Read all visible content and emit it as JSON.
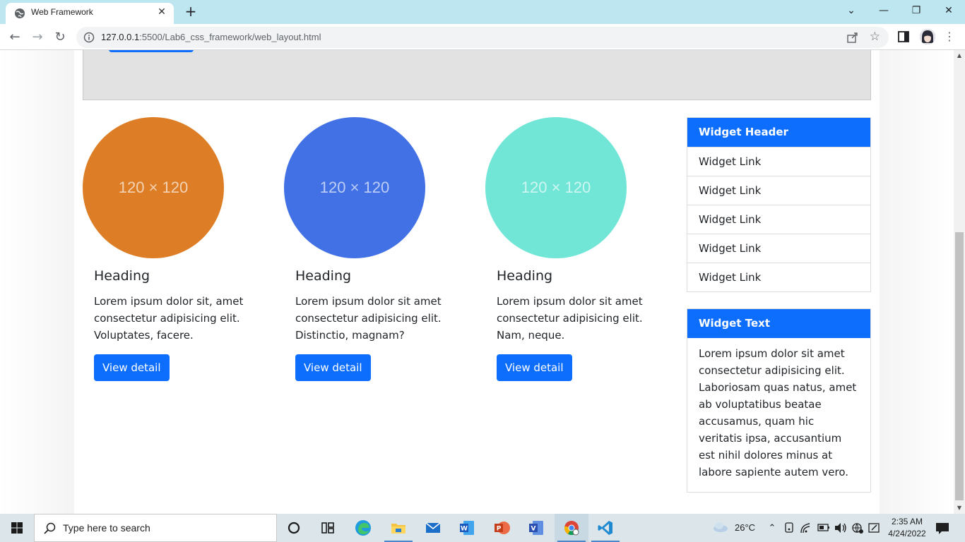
{
  "browser": {
    "tab_title": "Web Framework",
    "url_host": "127.0.0.1",
    "url_rest": ":5500/Lab6_css_framework/web_layout.html"
  },
  "page": {
    "cards": [
      {
        "placeholder": "120 × 120",
        "color": "#dd7e26",
        "heading": "Heading",
        "text": "Lorem ipsum dolor sit, amet consectetur adipisicing elit. Voluptates, facere.",
        "button": "View detail"
      },
      {
        "placeholder": "120 × 120",
        "color": "#4171e4",
        "heading": "Heading",
        "text": "Lorem ipsum dolor sit amet consectetur adipisicing elit. Distinctio, magnam?",
        "button": "View detail"
      },
      {
        "placeholder": "120 × 120",
        "color": "#71e6d6",
        "heading": "Heading",
        "text": "Lorem ipsum dolor sit amet consectetur adipisicing elit. Nam, neque.",
        "button": "View detail"
      }
    ],
    "widget_links": {
      "header": "Widget Header",
      "links": [
        "Widget Link",
        "Widget Link",
        "Widget Link",
        "Widget Link",
        "Widget Link"
      ]
    },
    "widget_text": {
      "header": "Widget Text",
      "body": "Lorem ipsum dolor sit amet consectetur adipisicing elit. Laboriosam quas natus, amet ab voluptatibus beatae accusamus, quam hic veritatis ipsa, accusantium est nihil dolores minus at labore sapiente autem vero."
    }
  },
  "taskbar": {
    "search_placeholder": "Type here to search",
    "weather": "26°C",
    "time": "2:35 AM",
    "date": "4/24/2022"
  },
  "colors": {
    "primary": "#0d6efd",
    "tabbar": "#bde6f0"
  }
}
